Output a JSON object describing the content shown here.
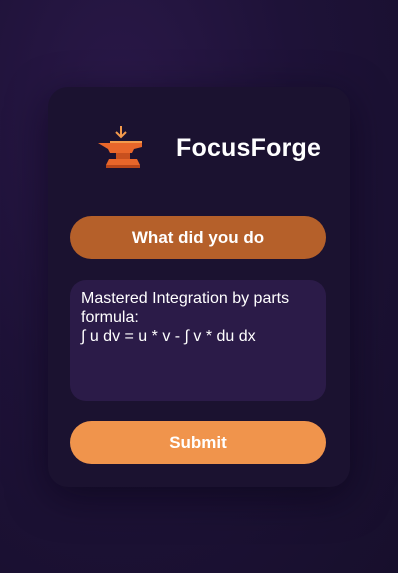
{
  "app": {
    "name": "FocusForge",
    "logo_icon": "anvil-icon"
  },
  "form": {
    "prompt_label": "What did you do",
    "entry_text": "Mastered Integration by parts formula:\n∫ u dv = u * v - ∫ v * du dx",
    "submit_label": "Submit"
  },
  "colors": {
    "background": "#1e1238",
    "card": "#1b1230",
    "prompt_button": "#b5602a",
    "entry_field": "#2b1b48",
    "submit_button": "#f0944c",
    "logo_orange": "#e8662a"
  }
}
